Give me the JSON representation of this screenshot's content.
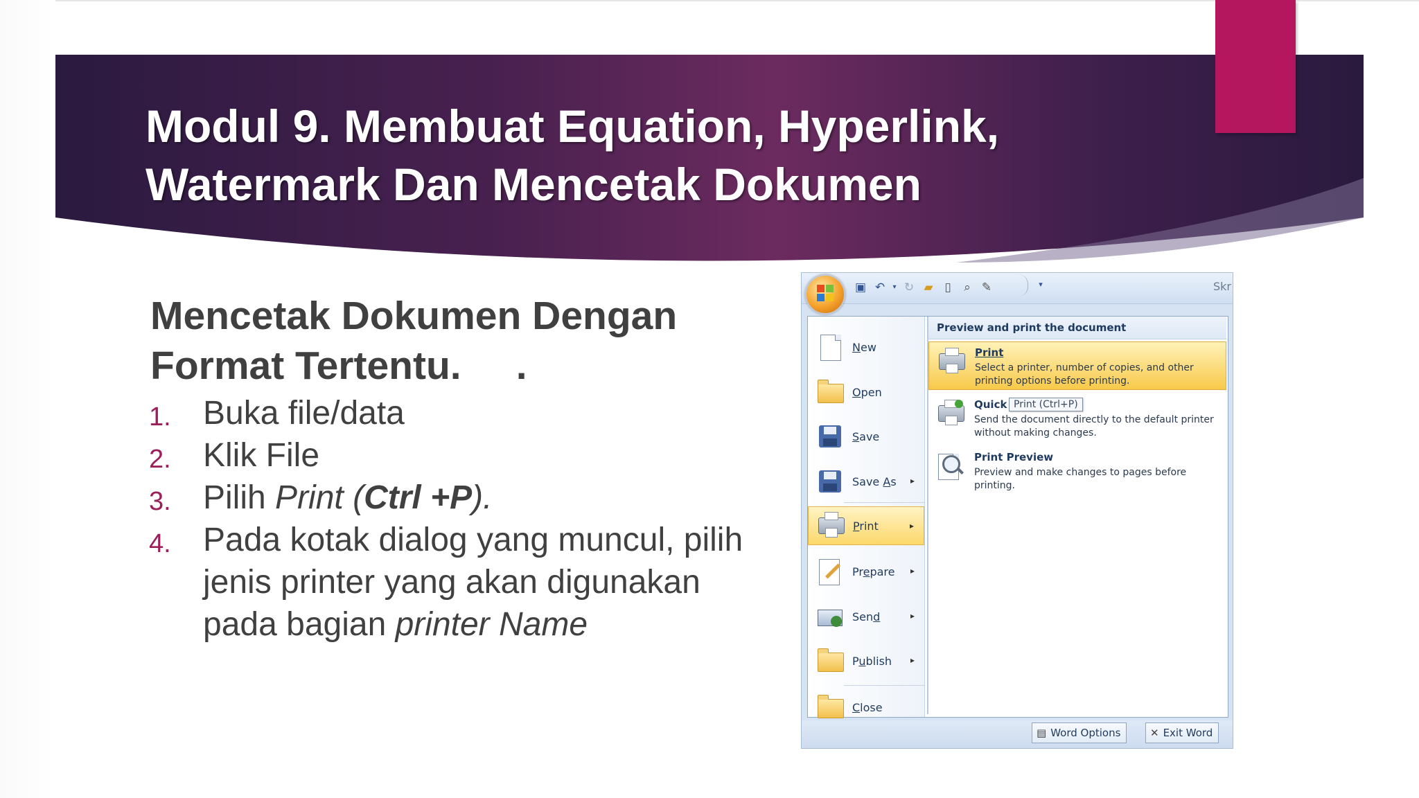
{
  "slide": {
    "title_line1": "Modul 9. Membuat Equation, Hyperlink,",
    "title_line2": "Watermark Dan Mencetak Dokumen",
    "subheading_line1": "Mencetak Dokumen Dengan",
    "subheading_line2": "Format Tertentu.     .",
    "steps": [
      {
        "num": "1.",
        "text": "Buka file/data"
      },
      {
        "num": "2.",
        "text": "Klik File"
      },
      {
        "num": "3.",
        "pre": "Pilih ",
        "italic": "Print",
        "open": " (",
        "bold": "Ctrl +P",
        "close": ")."
      },
      {
        "num": "4.",
        "text_line1": "Pada kotak dialog yang muncul, pilih",
        "text_line2": "jenis printer yang akan digunakan",
        "text_line3_pre": "pada bagian ",
        "text_line3_italic": "printer Name"
      }
    ],
    "colors": {
      "banner_dark": "#2e1c45",
      "banner_purple": "#6b2a5e",
      "accent_pink": "#b5175e",
      "number_color": "#9b1f5a",
      "text_color": "#404040"
    }
  },
  "office": {
    "qat_right_text": "Skr",
    "left_menu": [
      {
        "key": "N",
        "rest": "ew",
        "icon": "new-document-icon"
      },
      {
        "key": "O",
        "rest": "pen",
        "icon": "open-folder-icon"
      },
      {
        "key": "S",
        "rest": "ave",
        "icon": "save-disk-icon"
      },
      {
        "pre": "Save ",
        "key": "A",
        "rest": "s",
        "icon": "save-as-icon",
        "arrow": "▸"
      },
      {
        "key": "P",
        "rest": "rint",
        "icon": "printer-icon",
        "arrow": "▸"
      },
      {
        "pre": "Pr",
        "key": "e",
        "rest": "pare",
        "icon": "prepare-pencil-icon",
        "arrow": "▸"
      },
      {
        "pre": "Sen",
        "key": "d",
        "rest": "",
        "icon": "send-icon",
        "arrow": "▸"
      },
      {
        "pre": "P",
        "key": "u",
        "rest": "blish",
        "icon": "publish-folder-icon",
        "arrow": "▸"
      },
      {
        "key": "C",
        "rest": "lose",
        "icon": "close-folder-icon"
      }
    ],
    "right_header": "Preview and print the document",
    "options": [
      {
        "title": "Print",
        "desc": "Select a printer, number of copies, and other printing options before printing.",
        "icon": "printer-icon"
      },
      {
        "title": "Quick Print",
        "title_visible": "Quick",
        "desc": "Send the document directly to the default printer without making changes.",
        "icon": "quick-print-icon"
      },
      {
        "title": "Print Preview",
        "desc": "Preview and make changes to pages before printing.",
        "icon": "print-preview-magnifier-icon"
      }
    ],
    "tooltip": "Print (Ctrl+P)",
    "bottom_buttons": {
      "word_options": "Word Options",
      "exit_word": "Exit Word"
    }
  }
}
